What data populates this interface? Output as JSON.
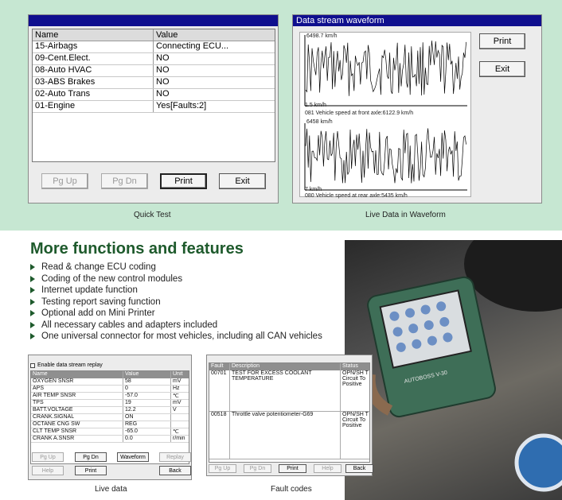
{
  "quick_test": {
    "columns": [
      "Name",
      "Value"
    ],
    "rows": [
      {
        "name": "15-Airbags",
        "value": "Connecting ECU..."
      },
      {
        "name": "09-Cent.Elect.",
        "value": "NO"
      },
      {
        "name": "08-Auto HVAC",
        "value": "NO"
      },
      {
        "name": "03-ABS Brakes",
        "value": "NO"
      },
      {
        "name": "02-Auto Trans",
        "value": "NO"
      },
      {
        "name": "01-Engine",
        "value": "Yes[Faults:2]"
      }
    ],
    "buttons": {
      "pg_up": "Pg Up",
      "pg_dn": "Pg Dn",
      "print": "Print",
      "exit": "Exit"
    },
    "caption": "Quick Test"
  },
  "waveform": {
    "title": "Data stream waveform",
    "chart1": {
      "max_label": "6498.7 km/h",
      "min_label": "1.5 km/h",
      "info": "081 Vehicle speed at front axle:6122.9 km/h"
    },
    "chart2": {
      "max_label": "6458 km/h",
      "min_label": "7 km/h",
      "info": "080 Vehicle speed at rear axle:5435 km/h"
    },
    "buttons": {
      "print": "Print",
      "exit": "Exit"
    },
    "caption": "Live Data in Waveform"
  },
  "features": {
    "heading": "More functions and features",
    "items": [
      "Read & change ECU coding",
      "Coding of the new control modules",
      "Internet update function",
      "Testing report saving function",
      "Optional add on Mini Printer",
      "All necessary cables and adapters included",
      "One universal connector for most vehicles, including all CAN vehicles"
    ]
  },
  "live_data": {
    "checkbox_label": "Enable data stream replay",
    "columns": [
      "Name",
      "Value",
      "Unit"
    ],
    "rows": [
      {
        "name": "OXYGEN SNSR",
        "value": "58",
        "unit": "mV"
      },
      {
        "name": "APS",
        "value": "0",
        "unit": "Hz"
      },
      {
        "name": "AIR TEMP SNSR",
        "value": "-57.0",
        "unit": "℃"
      },
      {
        "name": "TPS",
        "value": "19",
        "unit": "mV"
      },
      {
        "name": "BATT.VOLTAGE",
        "value": "12.2",
        "unit": "V"
      },
      {
        "name": "CRANK.SIGNAL",
        "value": "ON",
        "unit": ""
      },
      {
        "name": "OCTANE CNG SW",
        "value": "REG",
        "unit": ""
      },
      {
        "name": "CLT TEMP SNSR",
        "value": "-65.0",
        "unit": "℃"
      },
      {
        "name": "CRANK A.SNSR",
        "value": "0.0",
        "unit": "r/min"
      }
    ],
    "buttons": {
      "pg_up": "Pg Up",
      "pg_dn": "Pg Dn",
      "waveform": "Waveform",
      "replay": "Replay",
      "help": "Help",
      "print": "Print",
      "back": "Back"
    },
    "caption": "Live data"
  },
  "fault_codes": {
    "columns": [
      "Fault",
      "Description",
      "Status"
    ],
    "rows": [
      {
        "code": "00701",
        "description": "TEST FOR EXCESS COOLANT TEMPERATURE",
        "status": "OPN/SH T Circuit To Positive"
      },
      {
        "code": "00518",
        "description": "Throttle valve potentiometer-G69",
        "status": "OPN/SH T Circuit To Positive"
      }
    ],
    "buttons": {
      "pg_up": "Pg Up",
      "pg_dn": "Pg Dn",
      "print": "Print",
      "help": "Help",
      "back": "Back"
    },
    "caption": "Fault codes"
  },
  "photo": {
    "device_label": "AUTOBOSS V-30"
  },
  "colors": {
    "band": "#c6e7d2",
    "title_bar": "#0f0f8e",
    "heading": "#1e5a2c"
  }
}
